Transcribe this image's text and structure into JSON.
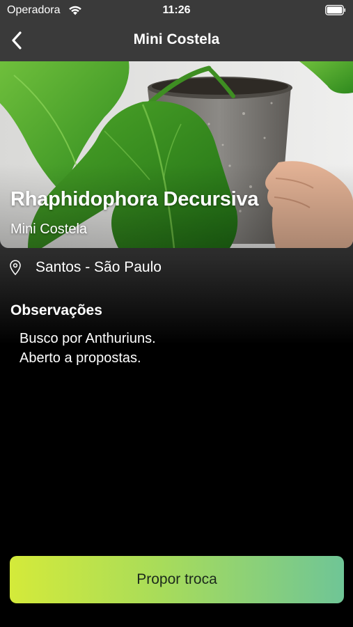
{
  "status_bar": {
    "carrier": "Operadora",
    "time": "11:26"
  },
  "nav": {
    "title": "Mini Costela"
  },
  "plant": {
    "scientific_name": "Rhaphidophora Decursiva",
    "common_name": "Mini Costela",
    "location": "Santos - São Paulo"
  },
  "observations": {
    "title": "Observações",
    "lines": [
      "Busco por Anthuriuns.",
      "Aberto a propostas."
    ]
  },
  "actions": {
    "propose_trade_label": "Propor troca"
  },
  "colors": {
    "background": "#000000",
    "header_gray": "#3a3a3a",
    "cta_gradient_start": "#d4ea3a",
    "cta_gradient_end": "#6fc596"
  },
  "icons": {
    "back": "chevron-left-icon",
    "location": "map-pin-icon",
    "wifi": "wifi-icon",
    "battery": "battery-icon"
  }
}
